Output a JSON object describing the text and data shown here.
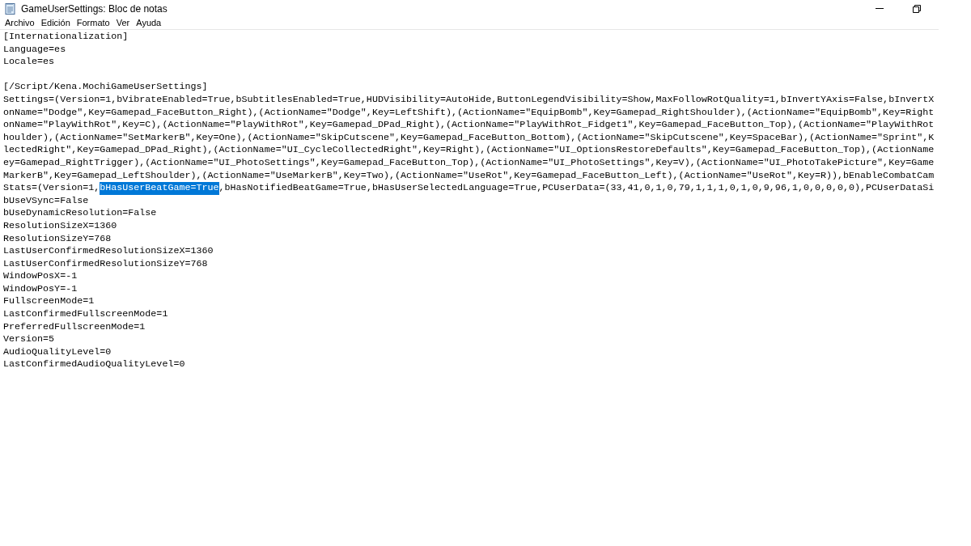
{
  "window": {
    "title": "GameUserSettings: Bloc de notas"
  },
  "menu": [
    "Archivo",
    "Edición",
    "Formato",
    "Ver",
    "Ayuda"
  ],
  "lines": [
    {
      "kind": "text",
      "parts": [
        {
          "text": "[Internationalization]",
          "selected": false
        }
      ]
    },
    {
      "kind": "text",
      "parts": [
        {
          "text": "Language=es",
          "selected": false
        }
      ]
    },
    {
      "kind": "text",
      "parts": [
        {
          "text": "Locale=es",
          "selected": false
        }
      ]
    },
    {
      "kind": "blank"
    },
    {
      "kind": "text",
      "parts": [
        {
          "text": "[/Script/Kena.MochiGameUserSettings]",
          "selected": false
        }
      ]
    },
    {
      "kind": "text",
      "parts": [
        {
          "text": "Settings=(Version=1,bVibrateEnabled=True,bSubtitlesEnabled=True,HUDVisibility=AutoHide,ButtonLegendVisibility=Show,MaxFollowRotQuality=1,bInvertYAxis=False,bInvertX",
          "selected": false
        }
      ]
    },
    {
      "kind": "text",
      "parts": [
        {
          "text": "onName=\"Dodge\",Key=Gamepad_FaceButton_Right),(ActionName=\"Dodge\",Key=LeftShift),(ActionName=\"EquipBomb\",Key=Gamepad_RightShoulder),(ActionName=\"EquipBomb\",Key=Right",
          "selected": false
        }
      ]
    },
    {
      "kind": "text",
      "parts": [
        {
          "text": "onName=\"PlayWithRot\",Key=C),(ActionName=\"PlayWithRot\",Key=Gamepad_DPad_Right),(ActionName=\"PlayWithRot_Fidget1\",Key=Gamepad_FaceButton_Top),(ActionName=\"PlayWithRot",
          "selected": false
        }
      ]
    },
    {
      "kind": "text",
      "parts": [
        {
          "text": "houlder),(ActionName=\"SetMarkerB\",Key=One),(ActionName=\"SkipCutscene\",Key=Gamepad_FaceButton_Bottom),(ActionName=\"SkipCutscene\",Key=SpaceBar),(ActionName=\"Sprint\",K",
          "selected": false
        }
      ]
    },
    {
      "kind": "text",
      "parts": [
        {
          "text": "lectedRight\",Key=Gamepad_DPad_Right),(ActionName=\"UI_CycleCollectedRight\",Key=Right),(ActionName=\"UI_OptionsRestoreDefaults\",Key=Gamepad_FaceButton_Top),(ActionName",
          "selected": false
        }
      ]
    },
    {
      "kind": "text",
      "parts": [
        {
          "text": "ey=Gamepad_RightTrigger),(ActionName=\"UI_PhotoSettings\",Key=Gamepad_FaceButton_Top),(ActionName=\"UI_PhotoSettings\",Key=V),(ActionName=\"UI_PhotoTakePicture\",Key=Game",
          "selected": false
        }
      ]
    },
    {
      "kind": "text",
      "parts": [
        {
          "text": "MarkerB\",Key=Gamepad_LeftShoulder),(ActionName=\"UseMarkerB\",Key=Two),(ActionName=\"UseRot\",Key=Gamepad_FaceButton_Left),(ActionName=\"UseRot\",Key=R)),bEnableCombatCam",
          "selected": false
        }
      ]
    },
    {
      "kind": "text",
      "parts": [
        {
          "text": "Stats=(Version=1,",
          "selected": false
        },
        {
          "text": "bHasUserBeatGame=True",
          "selected": true
        },
        {
          "text": ",bHasNotifiedBeatGame=True,bHasUserSelectedLanguage=True,PCUserData=(33,41,0,1,0,79,1,1,1,0,1,0,9,96,1,0,0,0,0,0),PCUserDataSi",
          "selected": false
        }
      ]
    },
    {
      "kind": "text",
      "parts": [
        {
          "text": "bUseVSync=False",
          "selected": false
        }
      ]
    },
    {
      "kind": "text",
      "parts": [
        {
          "text": "bUseDynamicResolution=False",
          "selected": false
        }
      ]
    },
    {
      "kind": "text",
      "parts": [
        {
          "text": "ResolutionSizeX=1360",
          "selected": false
        }
      ]
    },
    {
      "kind": "text",
      "parts": [
        {
          "text": "ResolutionSizeY=768",
          "selected": false
        }
      ]
    },
    {
      "kind": "text",
      "parts": [
        {
          "text": "LastUserConfirmedResolutionSizeX=1360",
          "selected": false
        }
      ]
    },
    {
      "kind": "text",
      "parts": [
        {
          "text": "LastUserConfirmedResolutionSizeY=768",
          "selected": false
        }
      ]
    },
    {
      "kind": "text",
      "parts": [
        {
          "text": "WindowPosX=-1",
          "selected": false
        }
      ]
    },
    {
      "kind": "text",
      "parts": [
        {
          "text": "WindowPosY=-1",
          "selected": false
        }
      ]
    },
    {
      "kind": "text",
      "parts": [
        {
          "text": "FullscreenMode=1",
          "selected": false
        }
      ]
    },
    {
      "kind": "text",
      "parts": [
        {
          "text": "LastConfirmedFullscreenMode=1",
          "selected": false
        }
      ]
    },
    {
      "kind": "text",
      "parts": [
        {
          "text": "PreferredFullscreenMode=1",
          "selected": false
        }
      ]
    },
    {
      "kind": "text",
      "parts": [
        {
          "text": "Version=5",
          "selected": false
        }
      ]
    },
    {
      "kind": "text",
      "parts": [
        {
          "text": "AudioQualityLevel=0",
          "selected": false
        }
      ]
    },
    {
      "kind": "text",
      "parts": [
        {
          "text": "LastConfirmedAudioQualityLevel=0",
          "selected": false
        }
      ]
    }
  ]
}
